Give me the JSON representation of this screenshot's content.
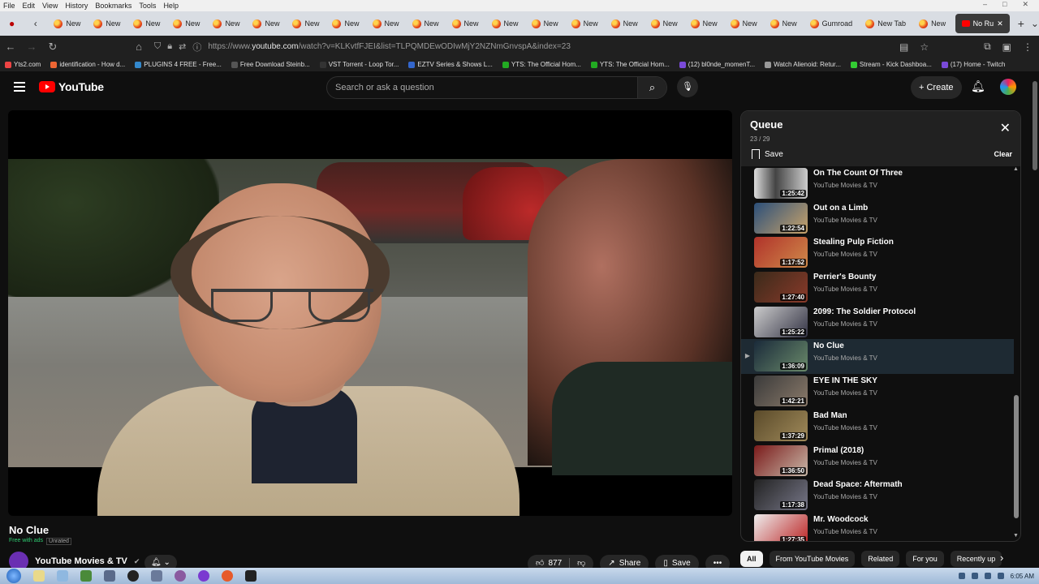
{
  "menubar": {
    "items": [
      "File",
      "Edit",
      "View",
      "History",
      "Bookmarks",
      "Tools",
      "Help"
    ]
  },
  "tabs": {
    "items": [
      "New",
      "New",
      "New",
      "New",
      "New",
      "New",
      "New",
      "New",
      "New",
      "New",
      "New",
      "New",
      "New",
      "New",
      "New",
      "New",
      "New",
      "New",
      "New",
      "Gumroad",
      "New Tab",
      "New"
    ],
    "active_label": "No Ru"
  },
  "toolbar": {
    "url_prefix": "https://www.",
    "url_host": "youtube.com",
    "url_rest": "/watch?v=KLKvtfFJEI&list=TLPQMDEwODIwMjY2NZNmGnvspA&index=23"
  },
  "bookmarks": {
    "items": [
      "Yts2.com",
      "identification - How d...",
      "PLUGINS 4 FREE - Free...",
      "Free Download Steinb...",
      "VST Torrent - Loop Tor...",
      "EZTV Series & Shows L...",
      "YTS: The Official Hom...",
      "YTS: The Official Hom...",
      "(12) bl0nde_momenT...",
      "Watch Alienoid: Retur...",
      "Stream - Kick Dashboa...",
      "(17) Home - Twitch"
    ]
  },
  "header": {
    "logo_text": "YouTube",
    "search_placeholder": "Search or ask a question",
    "create_label": "Create"
  },
  "video": {
    "title": "No Clue",
    "free_label": "Free with ads",
    "rating": "Unrated",
    "channel": "YouTube Movies & TV",
    "likes": "877",
    "share_label": "Share",
    "save_label": "Save"
  },
  "queue": {
    "title": "Queue",
    "position": "23 / 29",
    "save_label": "Save",
    "clear_label": "Clear",
    "items": [
      {
        "title": "On The Count Of Three",
        "channel": "YouTube Movies & TV",
        "duration": "1:25:42",
        "current": false
      },
      {
        "title": "Out on a Limb",
        "channel": "YouTube Movies & TV",
        "duration": "1:22:54",
        "current": false
      },
      {
        "title": "Stealing Pulp Fiction",
        "channel": "YouTube Movies & TV",
        "duration": "1:17:52",
        "current": false
      },
      {
        "title": "Perrier's Bounty",
        "channel": "YouTube Movies & TV",
        "duration": "1:27:40",
        "current": false
      },
      {
        "title": "2099: The Soldier Protocol",
        "channel": "YouTube Movies & TV",
        "duration": "1:25:22",
        "current": false
      },
      {
        "title": "No Clue",
        "channel": "YouTube Movies & TV",
        "duration": "1:36:09",
        "current": true
      },
      {
        "title": "EYE IN THE SKY",
        "channel": "YouTube Movies & TV",
        "duration": "1:42:21",
        "current": false
      },
      {
        "title": "Bad Man",
        "channel": "YouTube Movies & TV",
        "duration": "1:37:29",
        "current": false
      },
      {
        "title": "Primal (2018)",
        "channel": "YouTube Movies & TV",
        "duration": "1:36:50",
        "current": false
      },
      {
        "title": "Dead Space: Aftermath",
        "channel": "YouTube Movies & TV",
        "duration": "1:17:38",
        "current": false
      },
      {
        "title": "Mr. Woodcock",
        "channel": "YouTube Movies & TV",
        "duration": "1:27:35",
        "current": false
      }
    ]
  },
  "chips": [
    "All",
    "From YouTube Movies",
    "Related",
    "For you",
    "Recently up"
  ],
  "taskbar": {
    "clock": "6:05 AM"
  },
  "colors": {
    "accent": "#ff0000",
    "background": "#0f0f0f",
    "current_row": "#1e2a33"
  }
}
